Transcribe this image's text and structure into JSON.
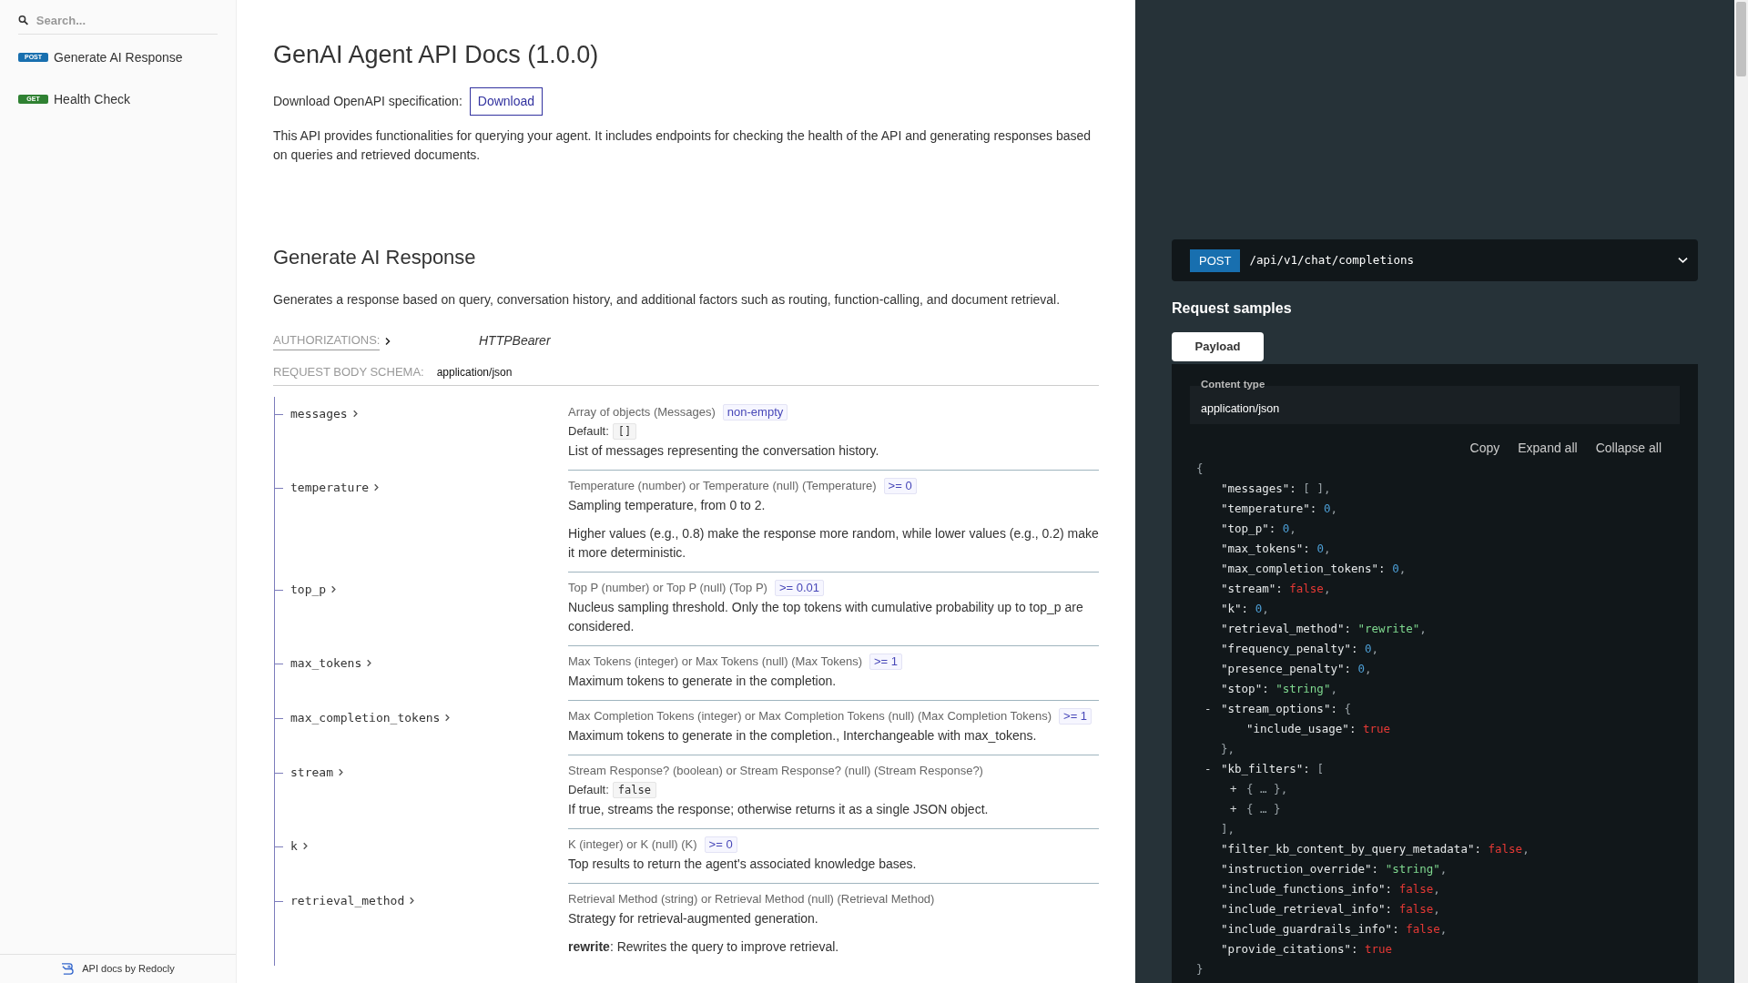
{
  "sidebar": {
    "search": {
      "placeholder": "Search..."
    },
    "items": [
      {
        "method": "POST",
        "kind": "post",
        "label": "Generate AI Response"
      },
      {
        "method": "GET",
        "kind": "get",
        "label": "Health Check"
      }
    ],
    "footer": "API docs by Redocly"
  },
  "main": {
    "title": "GenAI Agent API Docs (1.0.0)",
    "download_label": "Download OpenAPI specification:",
    "download_button": "Download",
    "description": "This API provides functionalities for querying your agent. It includes endpoints for checking the health of the API and generating responses based on queries and retrieved documents.",
    "operation": {
      "title": "Generate AI Response",
      "description": "Generates a response based on query, conversation history, and additional factors such as routing, function-calling, and document retrieval.",
      "authorizations_label": "AUTHORIZATIONS:",
      "authorization": "HTTPBearer",
      "schema_label": "REQUEST BODY SCHEMA:",
      "schema_type": "application/json",
      "params": [
        {
          "name": "messages",
          "type": "Array of objects (Messages)",
          "constraint": "non-empty",
          "default_label": "Default:",
          "default": "[]",
          "description": [
            "List of messages representing the conversation history."
          ]
        },
        {
          "name": "temperature",
          "type": "Temperature (number) or Temperature (null) (Temperature)",
          "constraint": ">= 0",
          "description": [
            "Sampling temperature, from 0 to 2.",
            "Higher values (e.g., 0.8) make the response more random, while lower values (e.g., 0.2) make it more deterministic."
          ]
        },
        {
          "name": "top_p",
          "type": "Top P (number) or Top P (null) (Top P)",
          "constraint": ">= 0.01",
          "description": [
            "Nucleus sampling threshold. Only the top tokens with cumulative probability up to top_p are considered."
          ]
        },
        {
          "name": "max_tokens",
          "type": "Max Tokens (integer) or Max Tokens (null) (Max Tokens)",
          "constraint": ">= 1",
          "description": [
            "Maximum tokens to generate in the completion."
          ]
        },
        {
          "name": "max_completion_tokens",
          "type": "Max Completion Tokens (integer) or Max Completion Tokens (null) (Max Completion Tokens)",
          "constraint": ">= 1",
          "description": [
            "Maximum tokens to generate in the completion., Interchangeable with max_tokens."
          ]
        },
        {
          "name": "stream",
          "type": "Stream Response? (boolean) or Stream Response? (null) (Stream Response?)",
          "default_label": "Default:",
          "default": "false",
          "description": [
            "If true, streams the response; otherwise returns it as a single JSON object."
          ]
        },
        {
          "name": "k",
          "type": "K (integer) or K (null) (K)",
          "constraint": ">= 0",
          "description": [
            "Top results to return the agent's associated knowledge bases."
          ]
        },
        {
          "name": "retrieval_method",
          "type": "Retrieval Method (string) or Retrieval Method (null) (Retrieval Method)",
          "description": [
            "Strategy for retrieval-augmented generation.",
            "**rewrite**: Rewrites the query to improve retrieval."
          ]
        }
      ]
    }
  },
  "right_panel": {
    "endpoint": {
      "method": "POST",
      "path": "/api/v1/chat/completions"
    },
    "request_samples_title": "Request samples",
    "tabs": [
      {
        "label": "Payload",
        "selected": true
      }
    ],
    "content_type_label": "Content type",
    "content_type": "application/json",
    "actions": [
      "Copy",
      "Expand all",
      "Collapse all"
    ],
    "sample": {
      "open": "{",
      "close": "}",
      "items": [
        {
          "key": "\"messages\":",
          "value": "[ ]",
          "kind": "punct",
          "tail": ","
        },
        {
          "key": "\"temperature\":",
          "value": "0",
          "kind": "number",
          "tail": ","
        },
        {
          "key": "\"top_p\":",
          "value": "0",
          "kind": "number",
          "tail": ","
        },
        {
          "key": "\"max_tokens\":",
          "value": "0",
          "kind": "number",
          "tail": ","
        },
        {
          "key": "\"max_completion_tokens\":",
          "value": "0",
          "kind": "number",
          "tail": ","
        },
        {
          "key": "\"stream\":",
          "value": "false",
          "kind": "boolean",
          "tail": ","
        },
        {
          "key": "\"k\":",
          "value": "0",
          "kind": "number",
          "tail": ","
        },
        {
          "key": "\"retrieval_method\":",
          "value": "\"rewrite\"",
          "kind": "string",
          "tail": ","
        },
        {
          "key": "\"frequency_penalty\":",
          "value": "0",
          "kind": "number",
          "tail": ","
        },
        {
          "key": "\"presence_penalty\":",
          "value": "0",
          "kind": "number",
          "tail": ","
        },
        {
          "key": "\"stop\":",
          "value": "\"string\"",
          "kind": "string",
          "tail": ","
        },
        {
          "toggle": "-",
          "key": "\"stream_options\":",
          "value": "{",
          "kind": "punct",
          "close": "},",
          "children": [
            {
              "key": "\"include_usage\":",
              "value": "true",
              "kind": "boolean"
            }
          ]
        },
        {
          "toggle": "-",
          "key": "\"kb_filters\":",
          "value": "[",
          "kind": "punct",
          "close": "],",
          "children": [
            {
              "toggle": "+",
              "value": "{ … }",
              "kind": "punct",
              "tail": ","
            },
            {
              "toggle": "+",
              "value": "{ … }",
              "kind": "punct"
            }
          ]
        },
        {
          "key": "\"filter_kb_content_by_query_metadata\":",
          "value": "false",
          "kind": "boolean",
          "tail": ","
        },
        {
          "key": "\"instruction_override\":",
          "value": "\"string\"",
          "kind": "string",
          "tail": ","
        },
        {
          "key": "\"include_functions_info\":",
          "value": "false",
          "kind": "boolean",
          "tail": ","
        },
        {
          "key": "\"include_retrieval_info\":",
          "value": "false",
          "kind": "boolean",
          "tail": ","
        },
        {
          "key": "\"include_guardrails_info\":",
          "value": "false",
          "kind": "boolean",
          "tail": ","
        },
        {
          "key": "\"provide_citations\":",
          "value": "true",
          "kind": "boolean"
        }
      ]
    }
  }
}
